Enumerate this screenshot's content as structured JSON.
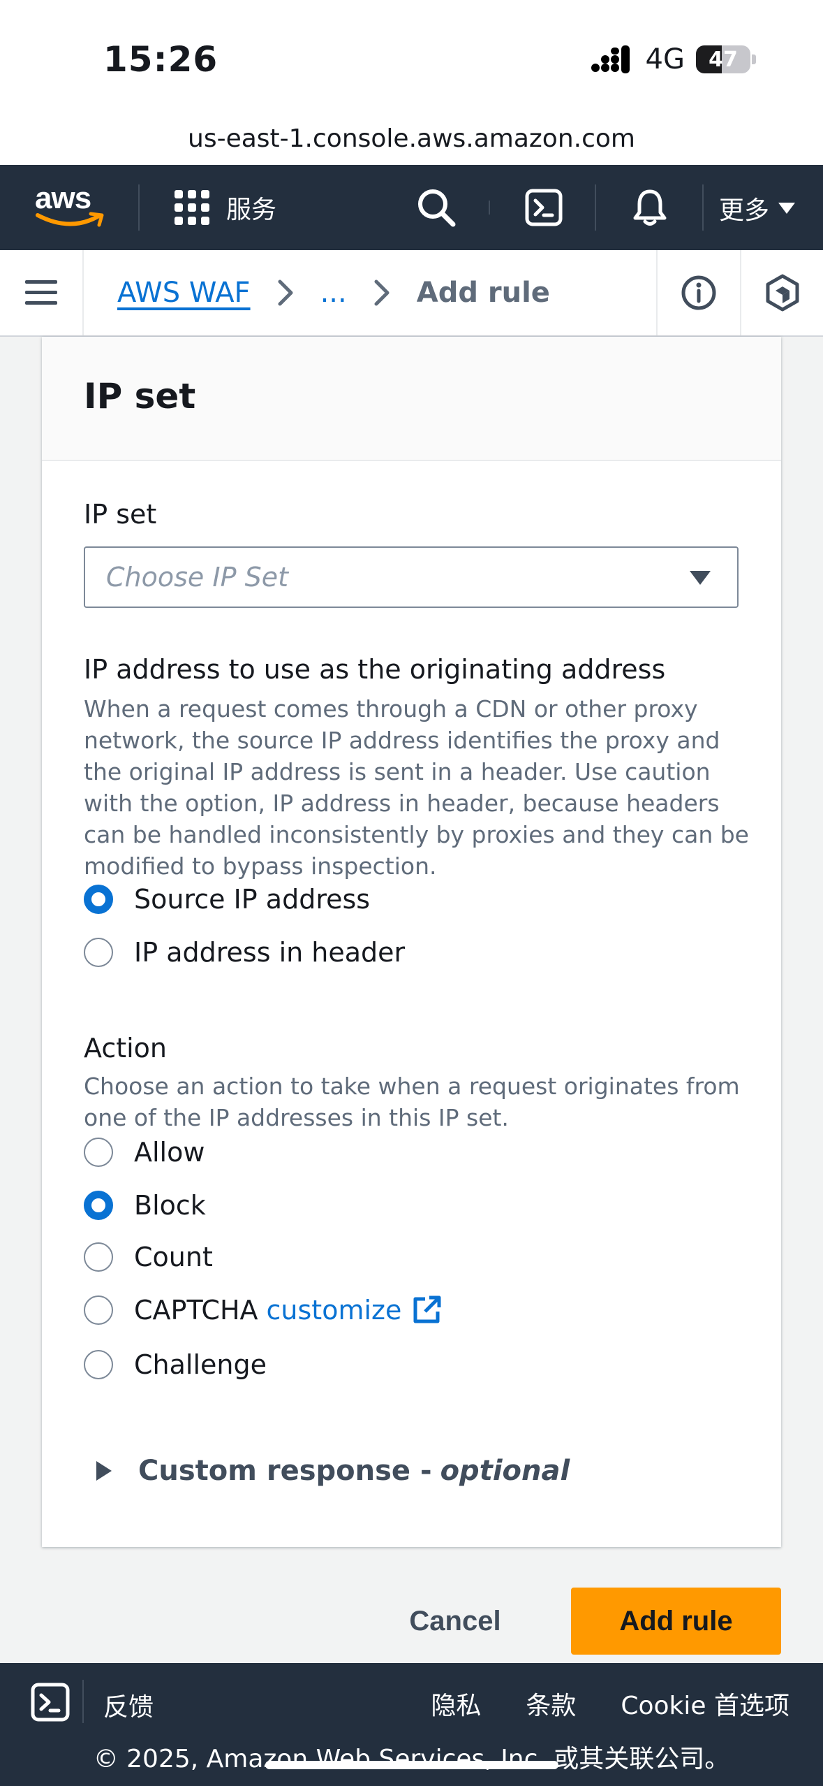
{
  "status": {
    "time": "15:26",
    "network": "4G",
    "battery": "47"
  },
  "browser": {
    "url": "us-east-1.console.aws.amazon.com"
  },
  "nav": {
    "logo": "aws",
    "services_label": "服务",
    "more_label": "更多"
  },
  "breadcrumb": {
    "service": "AWS WAF",
    "ellipsis": "...",
    "current": "Add rule"
  },
  "panel": {
    "title": "IP set",
    "ip_set": {
      "label": "IP set",
      "placeholder": "Choose IP Set"
    },
    "origin": {
      "label": "IP address to use as the originating address",
      "description": "When a request comes through a CDN or other proxy network, the source IP address identifies the proxy and the original IP address is sent in a header. Use caution with the option, IP address in header, because headers can be handled inconsistently by proxies and they can be modified to bypass inspection.",
      "options": [
        "Source IP address",
        "IP address in header"
      ],
      "selected": "Source IP address"
    },
    "action": {
      "label": "Action",
      "description": "Choose an action to take when a request originates from one of the IP addresses in this IP set.",
      "options": [
        "Allow",
        "Block",
        "Count",
        "CAPTCHA",
        "Challenge"
      ],
      "captcha_link": "customize",
      "selected": "Block"
    },
    "custom_response": {
      "label": "Custom response - ",
      "optional": "optional"
    }
  },
  "actions": {
    "cancel": "Cancel",
    "add_rule": "Add rule"
  },
  "footer": {
    "feedback": "反馈",
    "links": [
      "隐私",
      "条款",
      "Cookie 首选项"
    ],
    "copyright": "© 2025, Amazon Web Services, Inc. 或其关联公司。"
  },
  "colors": {
    "nav_bg": "#232f3e",
    "link": "#0972d3",
    "primary_button": "#ff9900"
  }
}
